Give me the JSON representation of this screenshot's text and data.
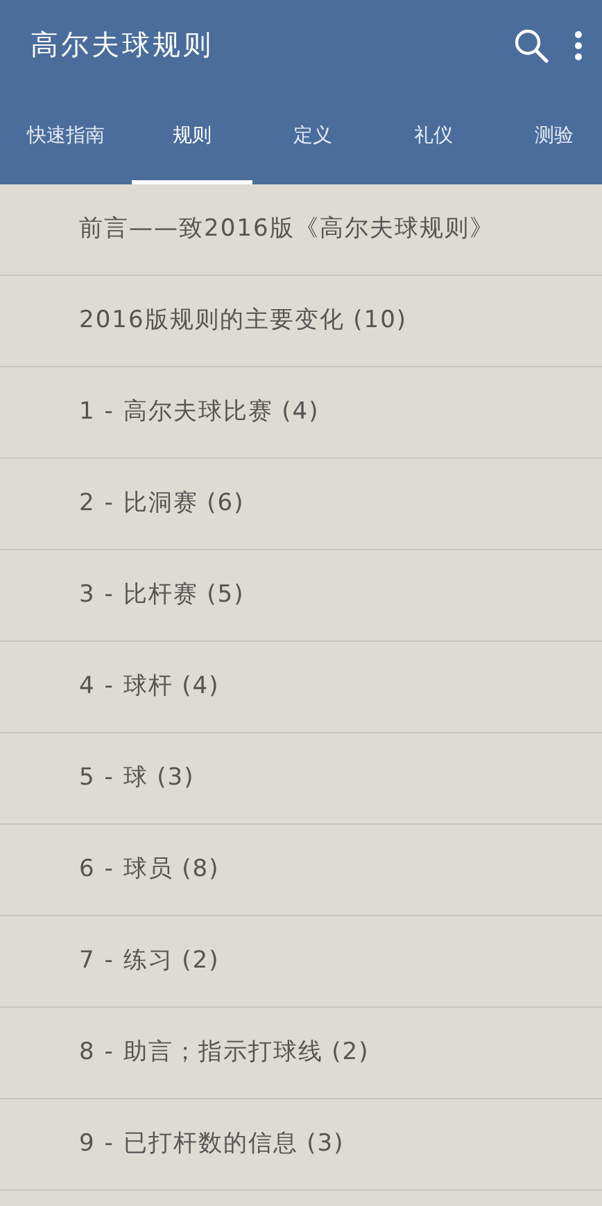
{
  "app_bar": {
    "title": "高尔夫球规则"
  },
  "tabs": [
    {
      "label": "快速指南",
      "selected": false
    },
    {
      "label": "规则",
      "selected": true
    },
    {
      "label": "定义",
      "selected": false
    },
    {
      "label": "礼仪",
      "selected": false
    },
    {
      "label": "测验",
      "selected": false
    }
  ],
  "items": [
    "前言——致2016版《高尔夫球规则》",
    "2016版规则的主要变化 (10)",
    "1 - 高尔夫球比赛 (4)",
    "2 - 比洞赛 (6)",
    "3 - 比杆赛 (5)",
    "4 - 球杆 (4)",
    "5 - 球 (3)",
    "6 - 球员 (8)",
    "7 - 练习 (2)",
    "8 - 助言；指示打球线 (2)",
    "9 - 已打杆数的信息 (3)"
  ]
}
